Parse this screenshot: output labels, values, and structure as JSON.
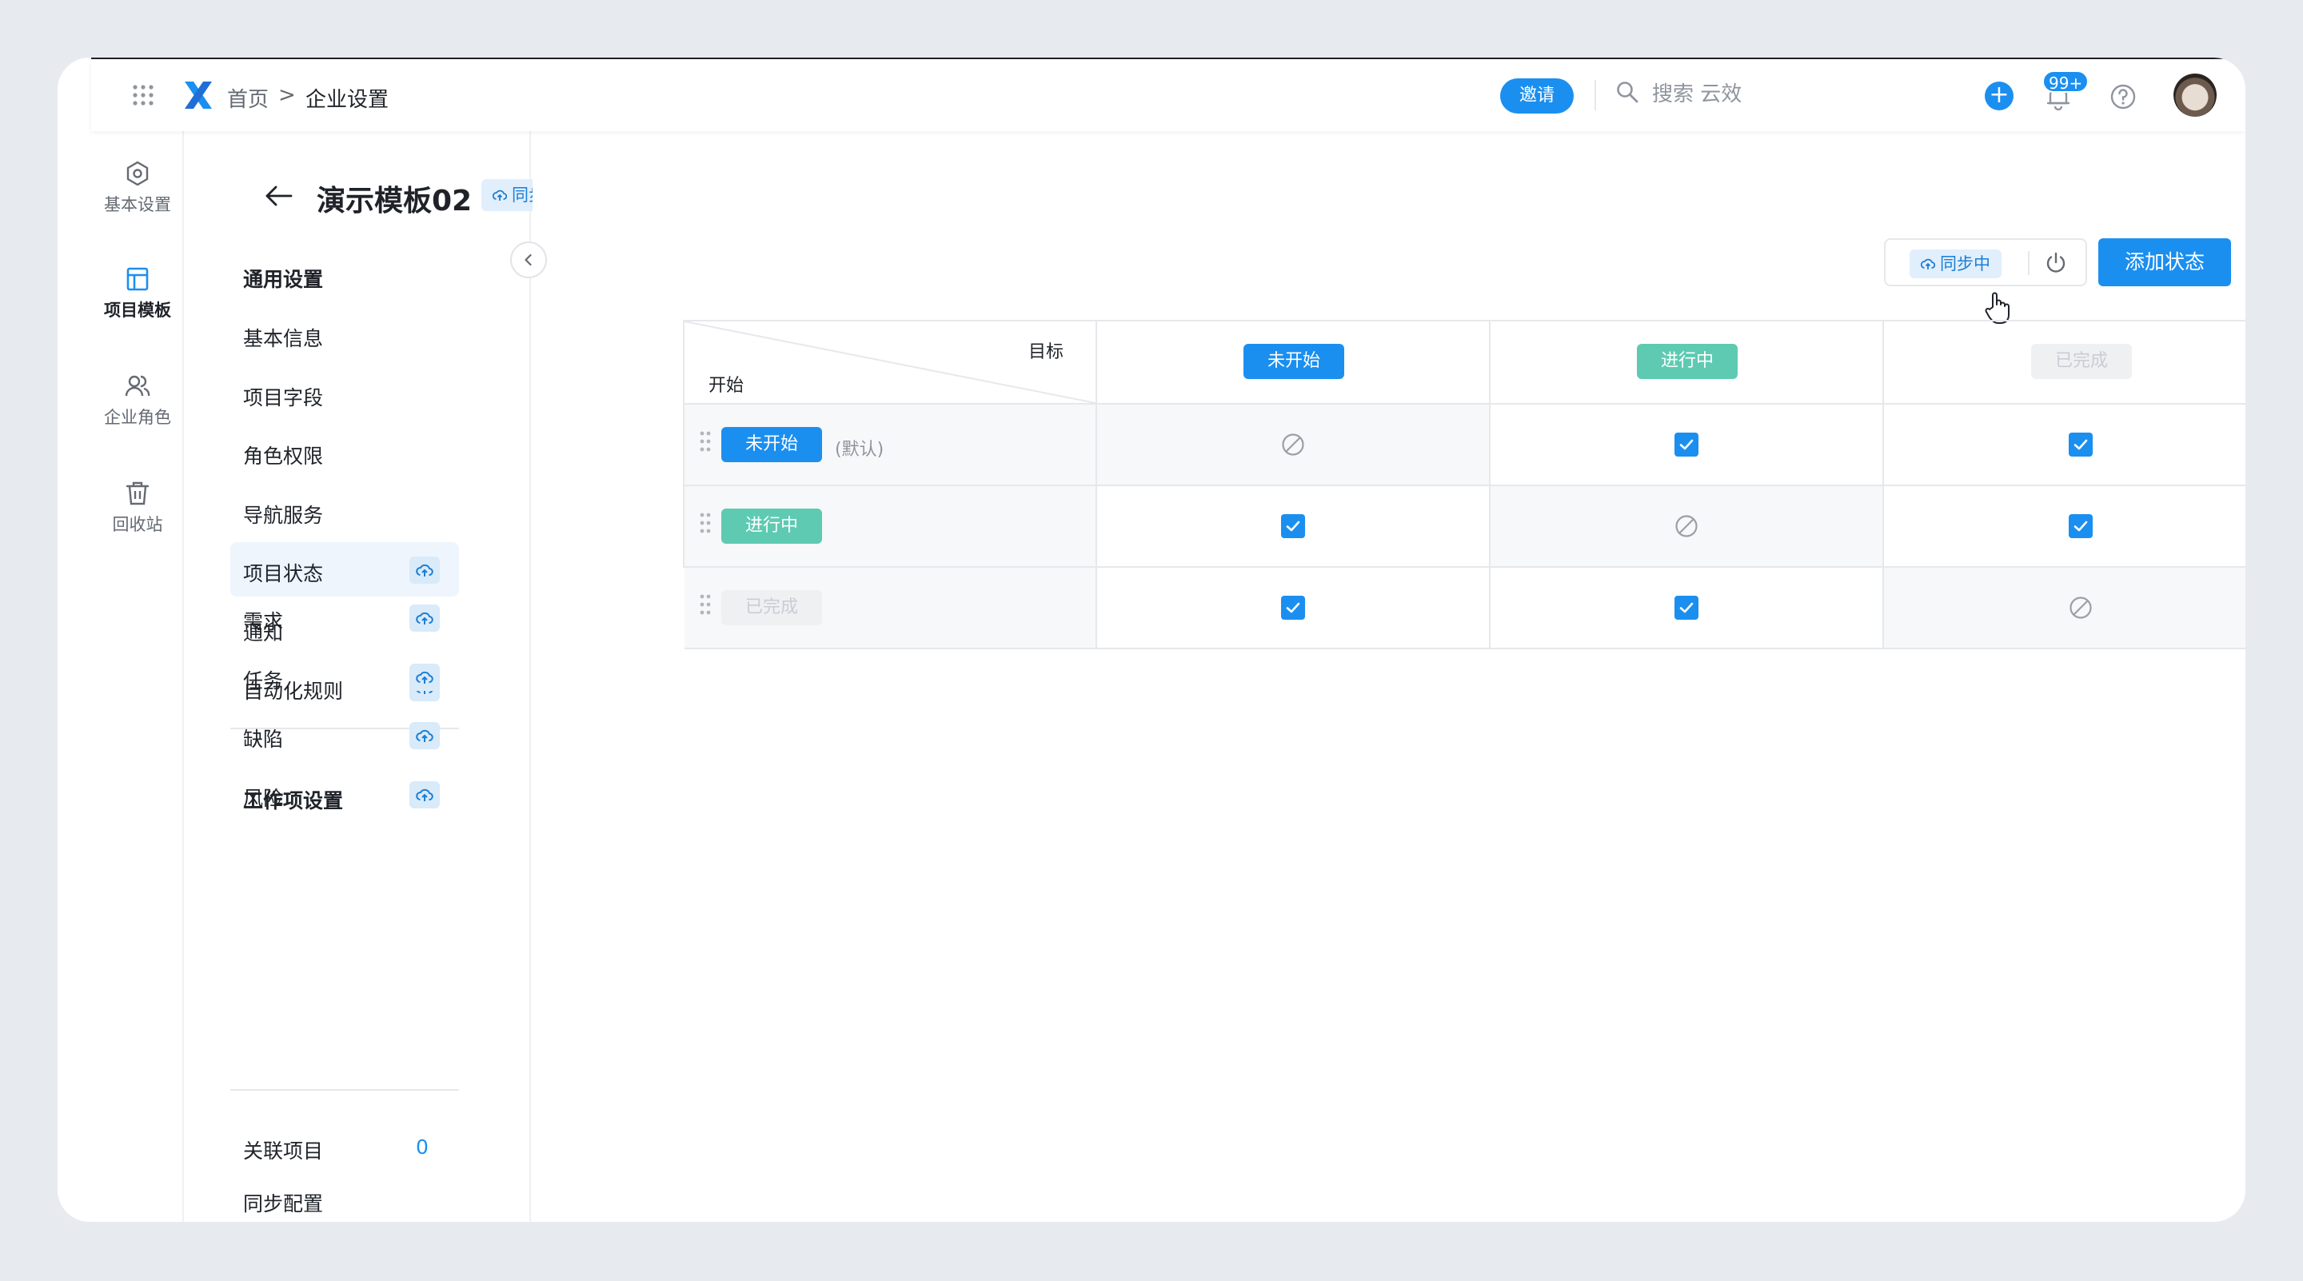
{
  "topbar": {
    "breadcrumb_home": "首页",
    "breadcrumb_sep": ">",
    "breadcrumb_current": "企业设置",
    "invite_label": "邀请",
    "search_placeholder": "搜索 云效",
    "notification_count": "99+",
    "add_icon": "+",
    "icons": [
      "apps-grid-icon",
      "logo-icon",
      "search-icon",
      "plus-icon",
      "bell-icon",
      "help-icon",
      "avatar"
    ]
  },
  "rail": {
    "items": [
      {
        "label": "基本设置",
        "icon": "settings-hex-icon",
        "active": false
      },
      {
        "label": "项目模板",
        "icon": "template-icon",
        "active": true
      },
      {
        "label": "企业角色",
        "icon": "users-icon",
        "active": false
      },
      {
        "label": "回收站",
        "icon": "trash-icon",
        "active": false
      }
    ]
  },
  "page": {
    "title": "演示模板02",
    "sync_tag": "同步"
  },
  "nav": {
    "general_title": "通用设置",
    "general_items": [
      {
        "label": "基本信息",
        "cloud": false
      },
      {
        "label": "项目字段",
        "cloud": false
      },
      {
        "label": "角色权限",
        "cloud": false
      },
      {
        "label": "导航服务",
        "cloud": false
      },
      {
        "label": "项目状态",
        "cloud": true,
        "active": true
      },
      {
        "label": "通知",
        "cloud": false
      },
      {
        "label": "自动化规则",
        "cloud": true
      }
    ],
    "work_title": "工作项设置",
    "work_items": [
      {
        "label": "需求",
        "cloud": true
      },
      {
        "label": "任务",
        "cloud": true
      },
      {
        "label": "缺陷",
        "cloud": true
      },
      {
        "label": "风险",
        "cloud": true
      }
    ],
    "extra_items": [
      {
        "label": "关联项目",
        "count": "0"
      },
      {
        "label": "同步配置"
      }
    ]
  },
  "toolbar": {
    "syncing_label": "同步中",
    "add_status_label": "添加状态"
  },
  "matrix": {
    "corner_target": "目标",
    "corner_start": "开始",
    "default_note": "(默认)",
    "statuses": [
      {
        "label": "未开始",
        "style": "blue"
      },
      {
        "label": "进行中",
        "style": "green"
      },
      {
        "label": "已完成",
        "style": "gray"
      }
    ],
    "transitions": [
      [
        "disabled",
        "checked",
        "checked"
      ],
      [
        "checked",
        "disabled",
        "checked"
      ],
      [
        "checked",
        "checked",
        "disabled"
      ]
    ]
  },
  "colors": {
    "primary": "#1b8ff0",
    "green": "#5ecab2",
    "gray_pill": "#eef0f2"
  }
}
